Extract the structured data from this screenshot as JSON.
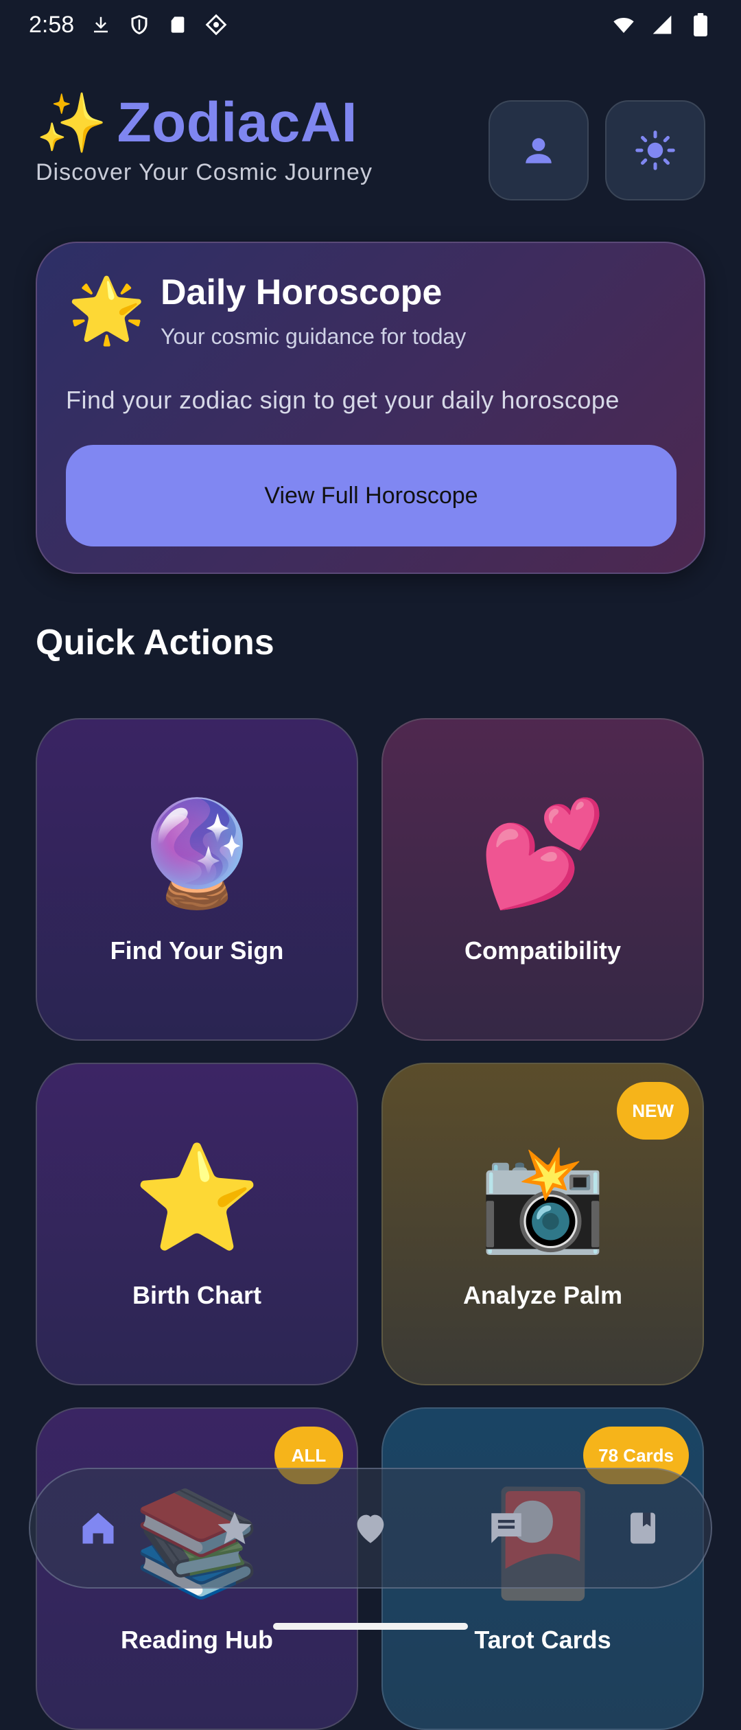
{
  "status": {
    "time": "2:58"
  },
  "header": {
    "title": "ZodiacAI",
    "subtitle": "Discover Your Cosmic Journey",
    "sparkle": "✨"
  },
  "horoscope": {
    "star": "🌟",
    "title": "Daily Horoscope",
    "subtitle": "Your cosmic guidance for today",
    "message": "Find your zodiac sign to get your daily horoscope",
    "button": "View Full Horoscope"
  },
  "quick_actions": {
    "title": "Quick Actions",
    "cards": [
      {
        "emoji": "🔮",
        "label": "Find Your Sign",
        "badge": ""
      },
      {
        "emoji": "💕",
        "label": "Compatibility",
        "badge": ""
      },
      {
        "emoji": "⭐",
        "label": "Birth Chart",
        "badge": ""
      },
      {
        "emoji": "📸",
        "label": "Analyze Palm",
        "badge": "NEW"
      },
      {
        "emoji": "📚",
        "label": "Reading Hub",
        "badge": "ALL"
      },
      {
        "emoji": "🎴",
        "label": "Tarot Cards",
        "badge": "78 Cards"
      }
    ]
  },
  "colors": {
    "accent": "#8087f2",
    "badge": "#f6b41a",
    "background": "#141b2c"
  },
  "nav": {
    "items": [
      "home-icon",
      "star-icon",
      "heart-icon",
      "chat-icon",
      "book-icon"
    ],
    "active": 0
  }
}
